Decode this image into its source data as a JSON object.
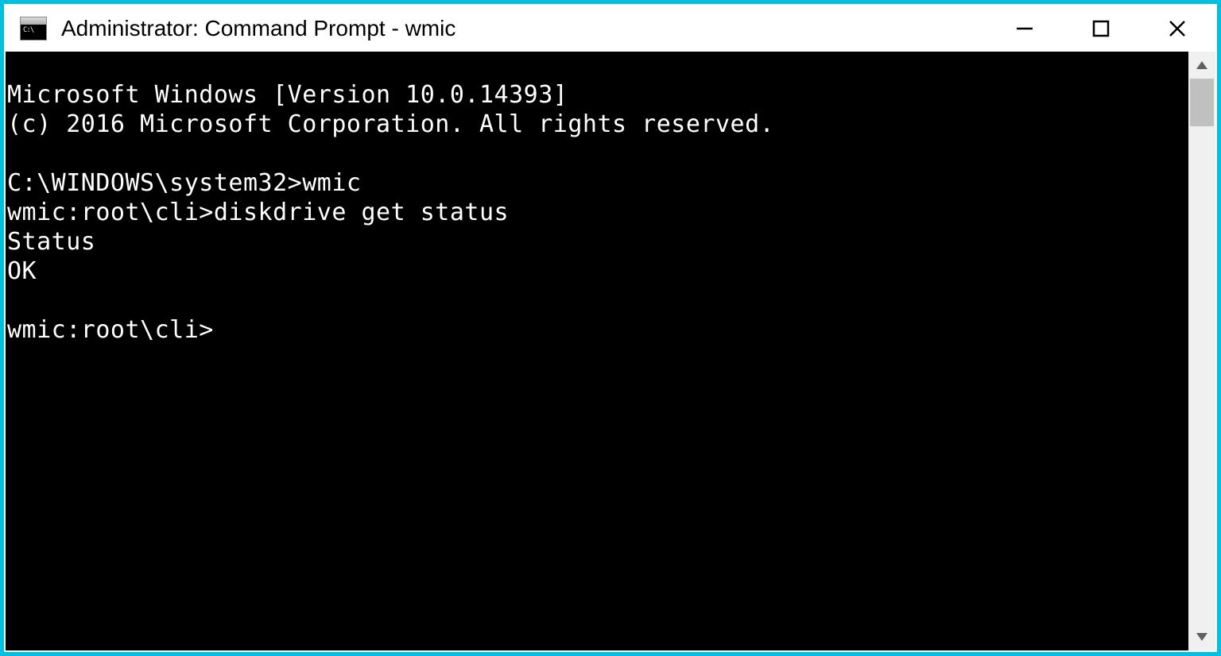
{
  "window": {
    "title": "Administrator: Command Prompt - wmic"
  },
  "terminal": {
    "lines": [
      "Microsoft Windows [Version 10.0.14393]",
      "(c) 2016 Microsoft Corporation. All rights reserved.",
      "",
      "C:\\WINDOWS\\system32>wmic",
      "wmic:root\\cli>diskdrive get status",
      "Status",
      "OK",
      "",
      "wmic:root\\cli>"
    ]
  },
  "icons": {
    "minimize": "minimize",
    "maximize": "maximize",
    "close": "close",
    "scroll_up": "▲",
    "scroll_down": "▼"
  }
}
